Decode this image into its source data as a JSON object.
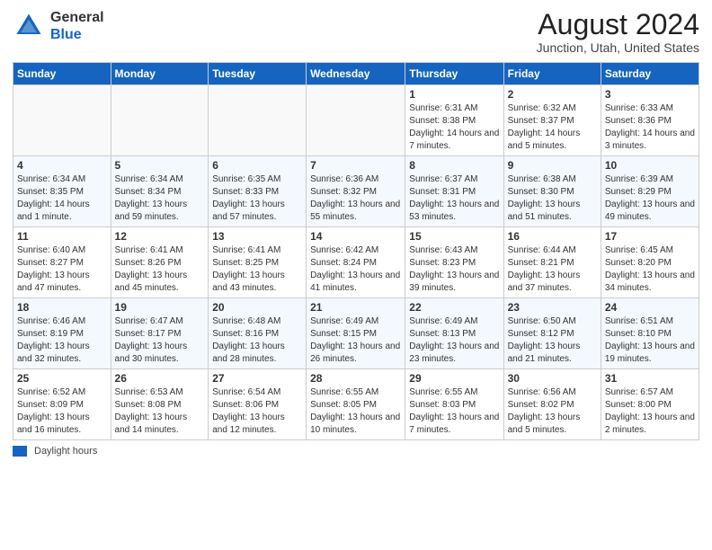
{
  "header": {
    "logo_line1": "General",
    "logo_line2": "Blue",
    "month_year": "August 2024",
    "location": "Junction, Utah, United States"
  },
  "legend": {
    "label": "Daylight hours"
  },
  "days_of_week": [
    "Sunday",
    "Monday",
    "Tuesday",
    "Wednesday",
    "Thursday",
    "Friday",
    "Saturday"
  ],
  "weeks": [
    {
      "days": [
        {
          "num": "",
          "info": ""
        },
        {
          "num": "",
          "info": ""
        },
        {
          "num": "",
          "info": ""
        },
        {
          "num": "",
          "info": ""
        },
        {
          "num": "1",
          "info": "Sunrise: 6:31 AM\nSunset: 8:38 PM\nDaylight: 14 hours and 7 minutes."
        },
        {
          "num": "2",
          "info": "Sunrise: 6:32 AM\nSunset: 8:37 PM\nDaylight: 14 hours and 5 minutes."
        },
        {
          "num": "3",
          "info": "Sunrise: 6:33 AM\nSunset: 8:36 PM\nDaylight: 14 hours and 3 minutes."
        }
      ]
    },
    {
      "days": [
        {
          "num": "4",
          "info": "Sunrise: 6:34 AM\nSunset: 8:35 PM\nDaylight: 14 hours and 1 minute."
        },
        {
          "num": "5",
          "info": "Sunrise: 6:34 AM\nSunset: 8:34 PM\nDaylight: 13 hours and 59 minutes."
        },
        {
          "num": "6",
          "info": "Sunrise: 6:35 AM\nSunset: 8:33 PM\nDaylight: 13 hours and 57 minutes."
        },
        {
          "num": "7",
          "info": "Sunrise: 6:36 AM\nSunset: 8:32 PM\nDaylight: 13 hours and 55 minutes."
        },
        {
          "num": "8",
          "info": "Sunrise: 6:37 AM\nSunset: 8:31 PM\nDaylight: 13 hours and 53 minutes."
        },
        {
          "num": "9",
          "info": "Sunrise: 6:38 AM\nSunset: 8:30 PM\nDaylight: 13 hours and 51 minutes."
        },
        {
          "num": "10",
          "info": "Sunrise: 6:39 AM\nSunset: 8:29 PM\nDaylight: 13 hours and 49 minutes."
        }
      ]
    },
    {
      "days": [
        {
          "num": "11",
          "info": "Sunrise: 6:40 AM\nSunset: 8:27 PM\nDaylight: 13 hours and 47 minutes."
        },
        {
          "num": "12",
          "info": "Sunrise: 6:41 AM\nSunset: 8:26 PM\nDaylight: 13 hours and 45 minutes."
        },
        {
          "num": "13",
          "info": "Sunrise: 6:41 AM\nSunset: 8:25 PM\nDaylight: 13 hours and 43 minutes."
        },
        {
          "num": "14",
          "info": "Sunrise: 6:42 AM\nSunset: 8:24 PM\nDaylight: 13 hours and 41 minutes."
        },
        {
          "num": "15",
          "info": "Sunrise: 6:43 AM\nSunset: 8:23 PM\nDaylight: 13 hours and 39 minutes."
        },
        {
          "num": "16",
          "info": "Sunrise: 6:44 AM\nSunset: 8:21 PM\nDaylight: 13 hours and 37 minutes."
        },
        {
          "num": "17",
          "info": "Sunrise: 6:45 AM\nSunset: 8:20 PM\nDaylight: 13 hours and 34 minutes."
        }
      ]
    },
    {
      "days": [
        {
          "num": "18",
          "info": "Sunrise: 6:46 AM\nSunset: 8:19 PM\nDaylight: 13 hours and 32 minutes."
        },
        {
          "num": "19",
          "info": "Sunrise: 6:47 AM\nSunset: 8:17 PM\nDaylight: 13 hours and 30 minutes."
        },
        {
          "num": "20",
          "info": "Sunrise: 6:48 AM\nSunset: 8:16 PM\nDaylight: 13 hours and 28 minutes."
        },
        {
          "num": "21",
          "info": "Sunrise: 6:49 AM\nSunset: 8:15 PM\nDaylight: 13 hours and 26 minutes."
        },
        {
          "num": "22",
          "info": "Sunrise: 6:49 AM\nSunset: 8:13 PM\nDaylight: 13 hours and 23 minutes."
        },
        {
          "num": "23",
          "info": "Sunrise: 6:50 AM\nSunset: 8:12 PM\nDaylight: 13 hours and 21 minutes."
        },
        {
          "num": "24",
          "info": "Sunrise: 6:51 AM\nSunset: 8:10 PM\nDaylight: 13 hours and 19 minutes."
        }
      ]
    },
    {
      "days": [
        {
          "num": "25",
          "info": "Sunrise: 6:52 AM\nSunset: 8:09 PM\nDaylight: 13 hours and 16 minutes."
        },
        {
          "num": "26",
          "info": "Sunrise: 6:53 AM\nSunset: 8:08 PM\nDaylight: 13 hours and 14 minutes."
        },
        {
          "num": "27",
          "info": "Sunrise: 6:54 AM\nSunset: 8:06 PM\nDaylight: 13 hours and 12 minutes."
        },
        {
          "num": "28",
          "info": "Sunrise: 6:55 AM\nSunset: 8:05 PM\nDaylight: 13 hours and 10 minutes."
        },
        {
          "num": "29",
          "info": "Sunrise: 6:55 AM\nSunset: 8:03 PM\nDaylight: 13 hours and 7 minutes."
        },
        {
          "num": "30",
          "info": "Sunrise: 6:56 AM\nSunset: 8:02 PM\nDaylight: 13 hours and 5 minutes."
        },
        {
          "num": "31",
          "info": "Sunrise: 6:57 AM\nSunset: 8:00 PM\nDaylight: 13 hours and 2 minutes."
        }
      ]
    }
  ]
}
